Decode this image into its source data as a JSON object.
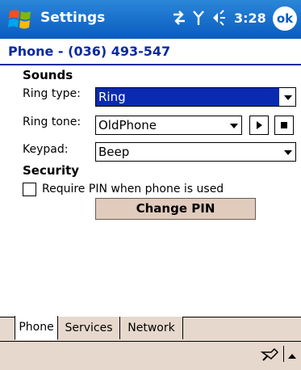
{
  "title_bar": {
    "app_title": "Settings",
    "time": "3:28",
    "ok_label": "ok",
    "icons": [
      "windows-start-icon",
      "connectivity-icon",
      "signal-icon",
      "volume-icon"
    ]
  },
  "header": {
    "title": "Phone - (036) 493-547"
  },
  "sounds": {
    "heading": "Sounds",
    "ring_type": {
      "label": "Ring type:",
      "value": "Ring"
    },
    "ring_tone": {
      "label": "Ring tone:",
      "value": "OldPhone"
    },
    "keypad": {
      "label": "Keypad:",
      "value": "Beep"
    }
  },
  "security": {
    "heading": "Security",
    "require_pin_label": "Require PIN when phone is used",
    "require_pin_checked": false,
    "change_pin_label": "Change PIN"
  },
  "tabs": [
    {
      "label": "Phone",
      "active": true
    },
    {
      "label": "Services",
      "active": false
    },
    {
      "label": "Network",
      "active": false
    }
  ],
  "menu_bar": {
    "icons": [
      "input-panel-icon",
      "input-arrow-icon"
    ]
  },
  "colors": {
    "title_bar": "#0a5cc0",
    "header_text": "#0a2aa0",
    "selection": "#0a2ab0",
    "tab_bar": "#e6d8cd"
  }
}
